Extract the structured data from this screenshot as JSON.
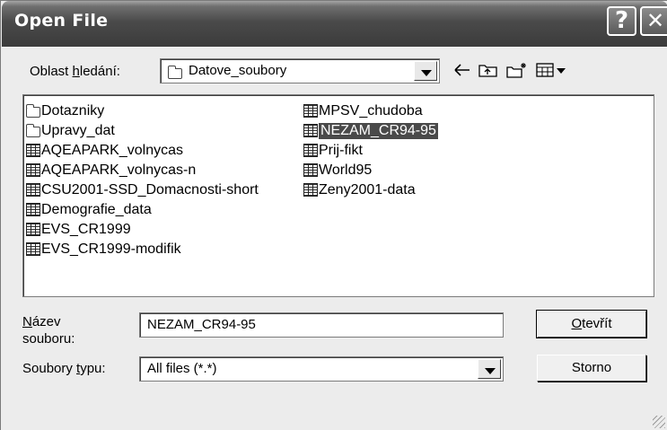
{
  "window": {
    "title": "Open File"
  },
  "titlebar": {
    "help_glyph": "?",
    "close_glyph": "✕"
  },
  "lookin": {
    "label_pre": "Oblast ",
    "label_accel": "h",
    "label_post": "ledání:",
    "value": "Datove_soubory"
  },
  "toolbar": {
    "back_icon": "back-arrow-icon",
    "up_icon": "up-folder-icon",
    "new_folder_icon": "new-folder-icon",
    "view_menu_icon": "view-menu-icon"
  },
  "files": {
    "column1": [
      {
        "name": "Dotazniky",
        "type": "folder"
      },
      {
        "name": "Upravy_dat",
        "type": "folder"
      },
      {
        "name": "AQEAPARK_volnycas",
        "type": "sav"
      },
      {
        "name": "AQEAPARK_volnycas-n",
        "type": "sav"
      },
      {
        "name": "CSU2001-SSD_Domacnosti-short",
        "type": "sav"
      },
      {
        "name": "Demografie_data",
        "type": "sav"
      },
      {
        "name": "EVS_CR1999",
        "type": "sav"
      },
      {
        "name": "EVS_CR1999-modifik",
        "type": "sav"
      }
    ],
    "column2": [
      {
        "name": "MPSV_chudoba",
        "type": "sav"
      },
      {
        "name": "NEZAM_CR94-95",
        "type": "sav",
        "selected": true
      },
      {
        "name": "Prij-fikt",
        "type": "sav"
      },
      {
        "name": "World95",
        "type": "sav"
      },
      {
        "name": "Zeny2001-data",
        "type": "sav"
      }
    ]
  },
  "filename": {
    "label_accel": "N",
    "label_line1_rest": "ázev",
    "label_line2": "souboru:",
    "value": "NEZAM_CR94-95"
  },
  "filetype": {
    "label_pre": "Soubory ",
    "label_accel": "t",
    "label_post": "ypu:",
    "value": "All files (*.*)"
  },
  "buttons": {
    "open_accel": "O",
    "open_rest": "tevřít",
    "cancel": "Storno"
  }
}
